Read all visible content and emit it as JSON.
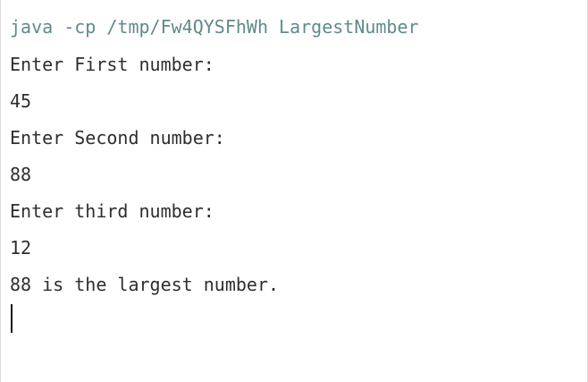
{
  "terminal": {
    "command": "java -cp /tmp/Fw4QYSFhWh LargestNumber",
    "lines": [
      "Enter First number:",
      "45",
      "Enter Second number:",
      "88",
      "Enter third number:",
      "12",
      "88 is the largest number."
    ]
  },
  "colors": {
    "command": "#5f8a8b",
    "text": "#2e2e2e",
    "background": "#ffffff"
  }
}
